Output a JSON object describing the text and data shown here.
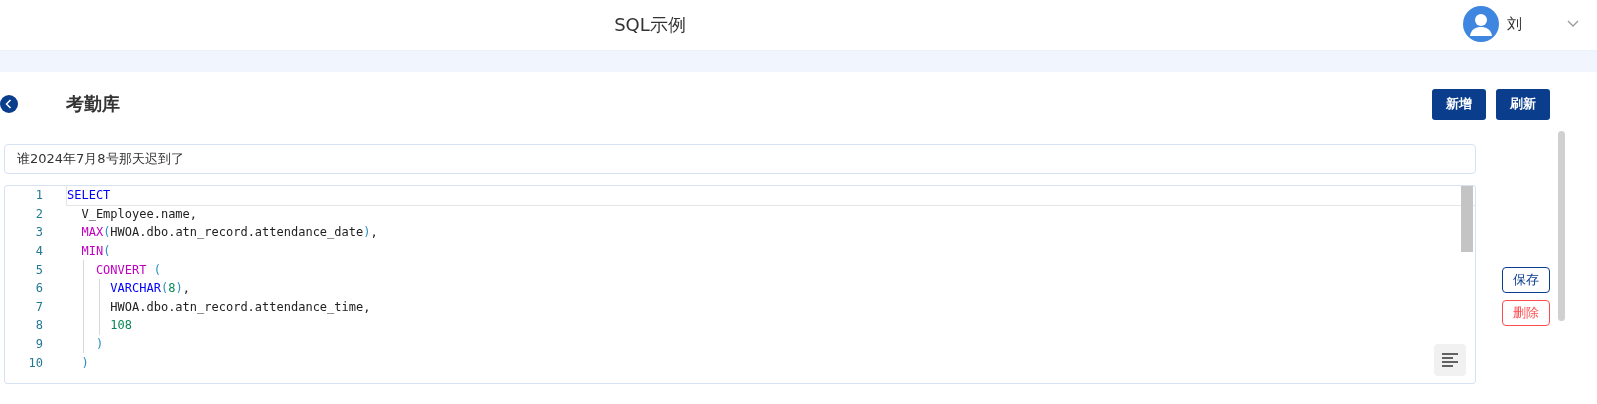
{
  "header": {
    "title": "SQL示例",
    "user": "刘"
  },
  "page": {
    "title": "考勤库",
    "buttons": [
      {
        "label": "新增"
      },
      {
        "label": "刷新"
      }
    ]
  },
  "question": {
    "value": "谁2024年7月8号那天迟到了"
  },
  "editor": {
    "lines": [
      {
        "number": "1",
        "current": true,
        "tokens": [
          {
            "kind": "keyword",
            "text": "SELECT"
          }
        ]
      },
      {
        "number": "2",
        "current": false,
        "tokens": [
          {
            "kind": "plain",
            "text": "  V_Employee.name,"
          }
        ]
      },
      {
        "number": "3",
        "current": false,
        "tokens": [
          {
            "kind": "function",
            "text": "  MAX"
          },
          {
            "kind": "paren",
            "text": "("
          },
          {
            "kind": "plain",
            "text": "HWOA.dbo.atn_record.attendance_date"
          },
          {
            "kind": "paren",
            "text": ")"
          },
          {
            "kind": "plain",
            "text": ","
          }
        ]
      },
      {
        "number": "4",
        "current": false,
        "tokens": [
          {
            "kind": "function",
            "text": "  MIN"
          },
          {
            "kind": "paren",
            "text": "("
          }
        ]
      },
      {
        "number": "5",
        "current": false,
        "tokens": [
          {
            "kind": "function",
            "text": "    CONVERT"
          },
          {
            "kind": "paren",
            "text": " ("
          }
        ]
      },
      {
        "number": "6",
        "current": false,
        "tokens": [
          {
            "kind": "keyword",
            "text": "      VARCHAR"
          },
          {
            "kind": "paren",
            "text": "("
          },
          {
            "kind": "number",
            "text": "8"
          },
          {
            "kind": "paren",
            "text": ")"
          },
          {
            "kind": "plain",
            "text": ","
          }
        ]
      },
      {
        "number": "7",
        "current": false,
        "tokens": [
          {
            "kind": "plain",
            "text": "      HWOA.dbo.atn_record.attendance_time,"
          }
        ]
      },
      {
        "number": "8",
        "current": false,
        "tokens": [
          {
            "kind": "number",
            "text": "      108"
          }
        ]
      },
      {
        "number": "9",
        "current": false,
        "tokens": [
          {
            "kind": "paren",
            "text": "    )"
          }
        ]
      },
      {
        "number": "10",
        "current": false,
        "tokens": [
          {
            "kind": "paren",
            "text": "  )"
          }
        ]
      }
    ]
  },
  "side_buttons": [
    {
      "label": "保存",
      "kind": "primary"
    },
    {
      "label": "删除",
      "kind": "danger"
    }
  ]
}
